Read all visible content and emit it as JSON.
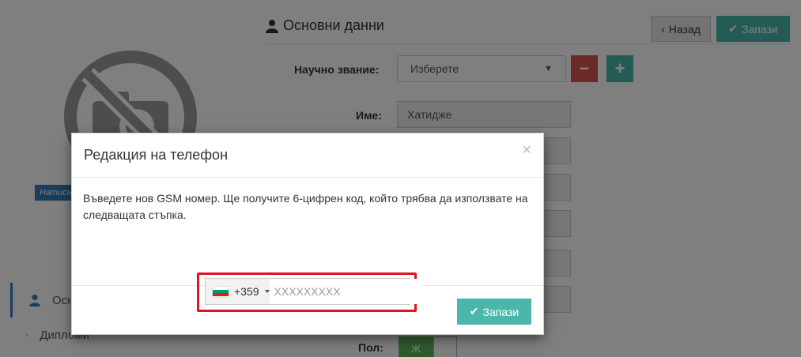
{
  "page": {
    "upload_hint": "Натисн",
    "section_title": "Основни данни",
    "actions": {
      "back_label": "Назад",
      "save_label": "Запази"
    },
    "form": {
      "academic_title": {
        "label": "Научно звание:",
        "selected": "Изберете",
        "remove": "−",
        "add": "+"
      },
      "first_name": {
        "label": "Име:",
        "value": "Хатидже"
      },
      "gender": {
        "label": "Пол:",
        "female": "Ж"
      }
    },
    "side_nav": {
      "items": [
        {
          "label": "Осн"
        },
        {
          "label": "Дипломи"
        }
      ]
    }
  },
  "modal": {
    "title": "Редакция на телефон",
    "close": "×",
    "instructions": "Въведете нов GSM номер. Ще получите 6-цифрен код, който трябва да използвате на следващата стъпка.",
    "phone": {
      "dial_code": "+359",
      "flag_colors": [
        "#ffffff",
        "#00966e",
        "#d62612"
      ],
      "placeholder": "XXXXXXXXX",
      "value": ""
    },
    "save_label": "Запази"
  },
  "colors": {
    "accent": "#4bb7ab",
    "danger": "#d9534f",
    "highlight": "#e2141b"
  }
}
